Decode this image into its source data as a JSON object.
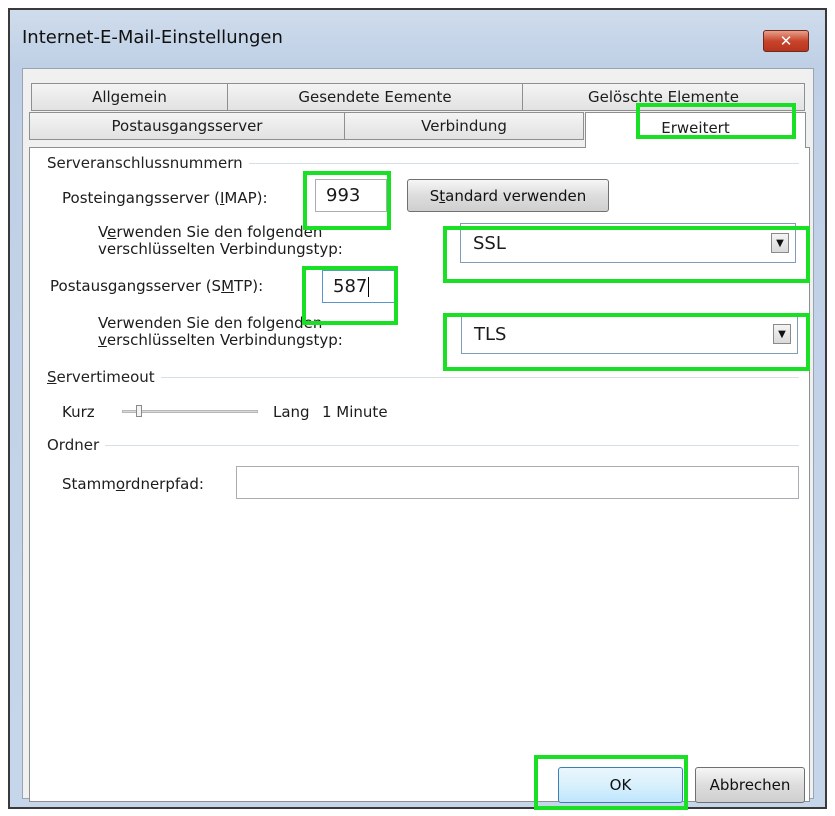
{
  "window": {
    "title": "Internet-E-Mail-Einstellungen",
    "close_symbol": "✕"
  },
  "tabs": {
    "row1": [
      "Allgemein",
      "Gesendete Eemente",
      "Gelöschte Elemente"
    ],
    "row2": [
      "Postausgangsserver",
      "Verbindung",
      "Erweitert"
    ],
    "active": "Erweitert"
  },
  "server_ports": {
    "group_label": "Serveranschlussnummern",
    "incoming_label": "Posteingangsserver (IMAP):",
    "incoming_value": "993",
    "default_button": "Standard verwenden",
    "incoming_encryption_label_1": "Verwenden Sie den folgenden",
    "incoming_encryption_label_2": "verschlüsselten Verbindungstyp:",
    "incoming_encryption_value": "SSL",
    "outgoing_label": "Postausgangsserver (SMTP):",
    "outgoing_value": "587",
    "outgoing_encryption_label_1": "Verwenden Sie den folgenden",
    "outgoing_encryption_label_2": "verschlüsselten Verbindungstyp:",
    "outgoing_encryption_value": "TLS"
  },
  "timeout": {
    "group_label": "Servertimeout",
    "short_label": "Kurz",
    "long_label": "Lang",
    "value": "1 Minute"
  },
  "folders": {
    "group_label": "Ordner",
    "root_path_label": "Stammordnerpfad:",
    "root_path_value": ""
  },
  "buttons": {
    "ok": "OK",
    "cancel": "Abbrechen"
  },
  "highlight_color": "#19e024"
}
